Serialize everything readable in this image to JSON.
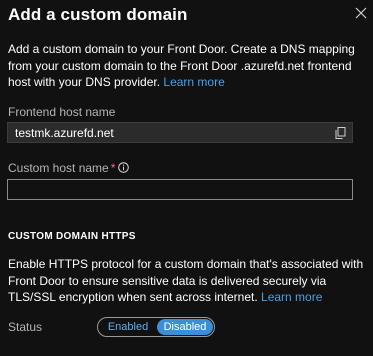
{
  "panel": {
    "title": "Add a custom domain",
    "close_icon": "close-icon"
  },
  "intro": {
    "text": "Add a custom domain to your Front Door. Create a DNS mapping from your custom domain to the Front Door .azurefd.net frontend host with your DNS provider.",
    "link": "Learn more"
  },
  "frontend_host": {
    "label": "Frontend host name",
    "value": "testmk.azurefd.net",
    "copy_icon": "copy-icon"
  },
  "custom_host": {
    "label": "Custom host name",
    "required_marker": "*",
    "info_icon": "info-icon",
    "value": "",
    "placeholder": ""
  },
  "https_section": {
    "heading": "CUSTOM DOMAIN HTTPS",
    "text": "Enable HTTPS protocol for a custom domain that's associated with Front Door to ensure sensitive data is delivered securely via TLS/SSL encryption when sent across internet.",
    "link": "Learn more"
  },
  "status": {
    "label": "Status",
    "options": [
      "Enabled",
      "Disabled"
    ],
    "selected": "Disabled"
  },
  "colors": {
    "background": "#111111",
    "link": "#4aa0e6",
    "toggle_selected": "#3a8fd6",
    "required": "#ff6b6b"
  }
}
